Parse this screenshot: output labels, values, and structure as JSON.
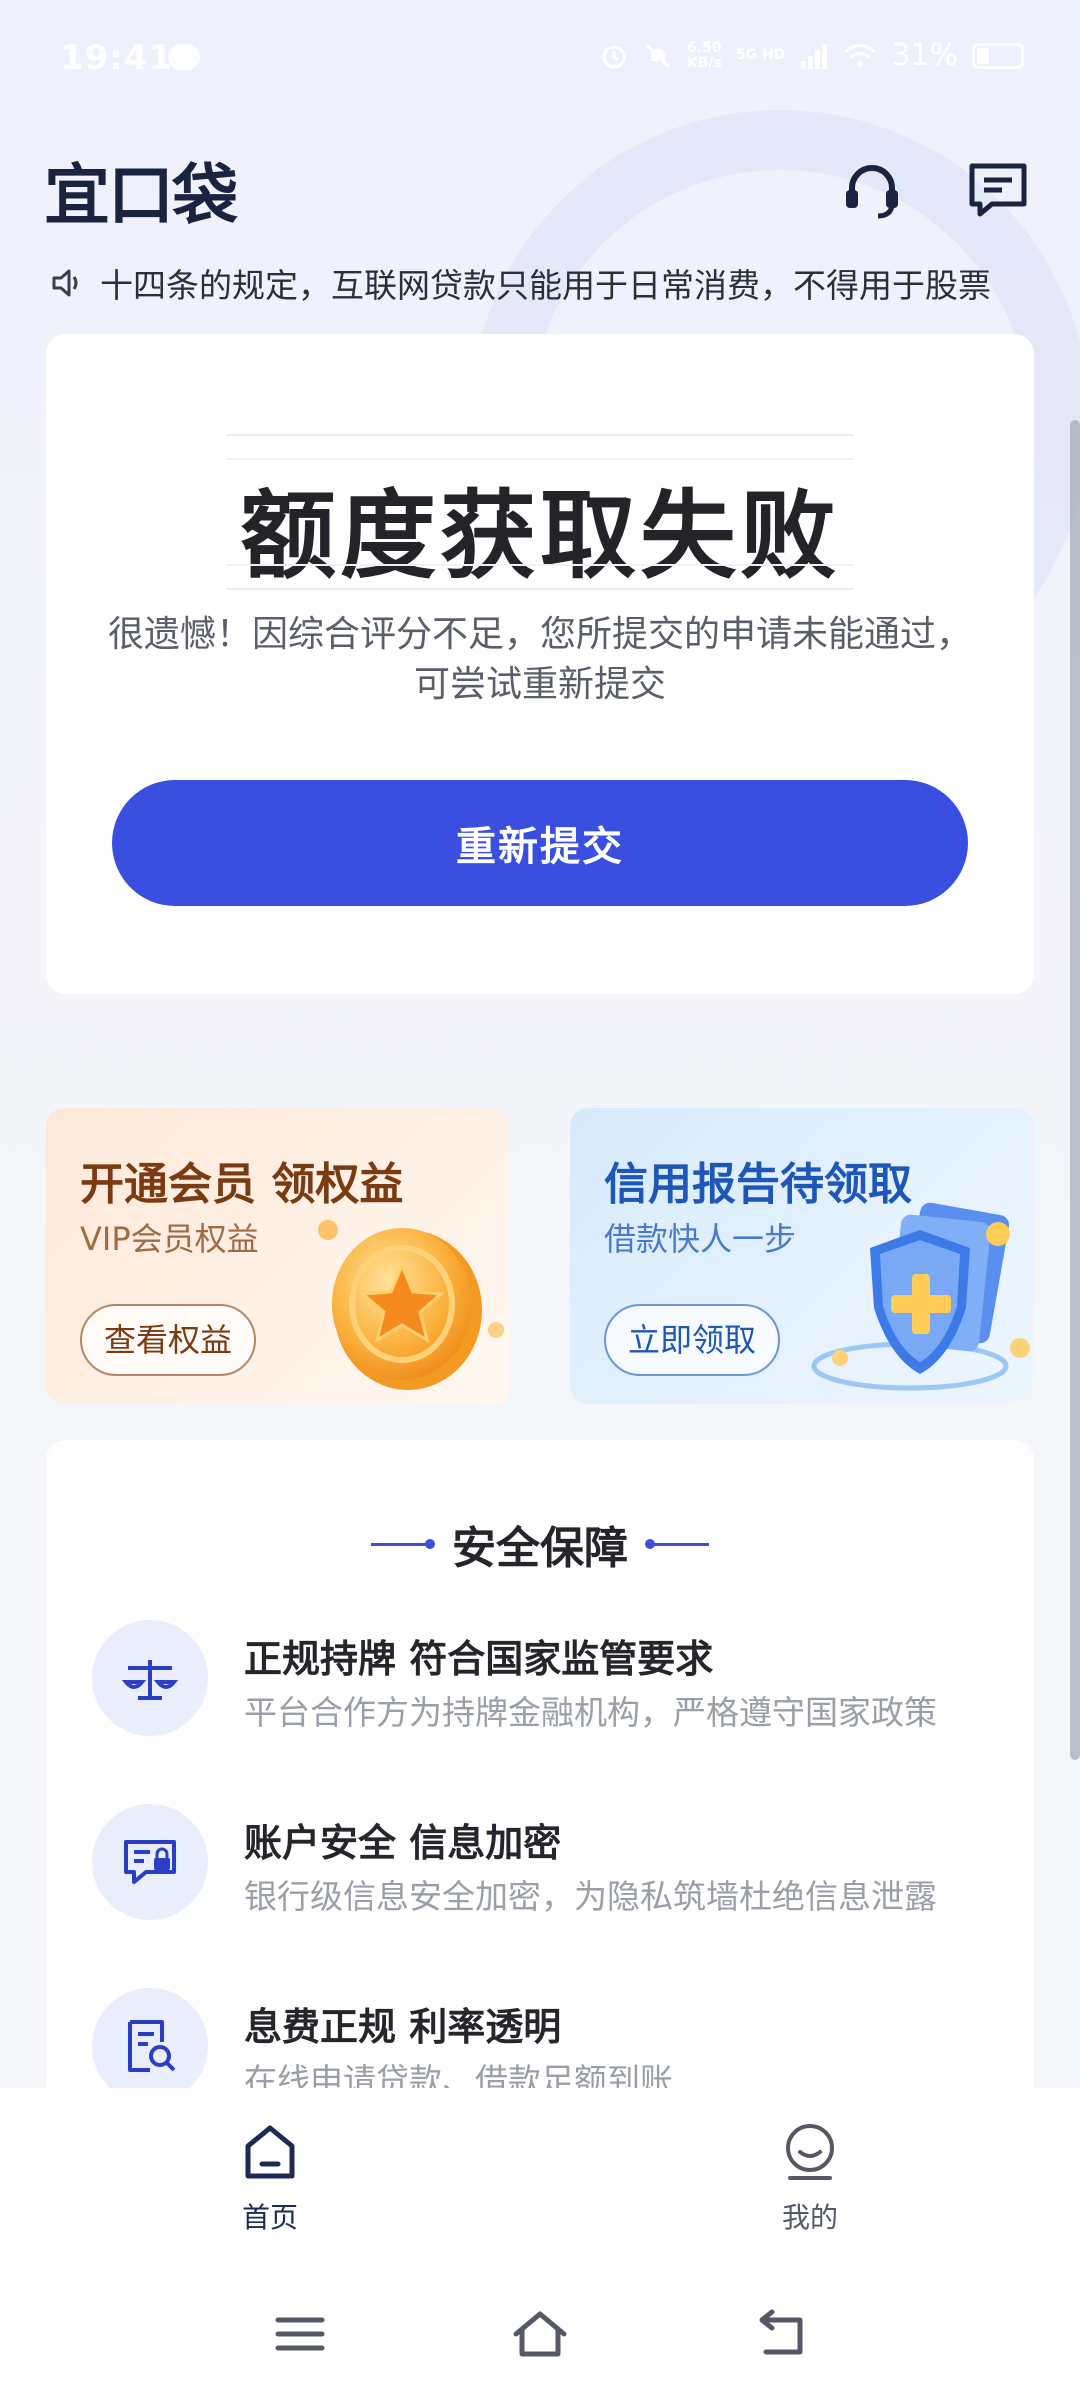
{
  "status_bar": {
    "time": "19:41",
    "speed_value": "6.50",
    "speed_unit": "KB/s",
    "network": "5G HD",
    "battery": "31%"
  },
  "header": {
    "logo": "宜口袋"
  },
  "notice": {
    "text": "十四条的规定，互联网贷款只能用于日常消费，不得用于股票"
  },
  "result": {
    "title": "额度获取失败",
    "description": "很遗憾！因综合评分不足，您所提交的申请未能通过，可尝试重新提交",
    "button_label": "重新提交"
  },
  "promos": [
    {
      "title": "开通会员 领权益",
      "subtitle": "VIP会员权益",
      "button_label": "查看权益"
    },
    {
      "title": "信用报告待领取",
      "subtitle": "借款快人一步",
      "button_label": "立即领取"
    }
  ],
  "safety": {
    "title": "安全保障",
    "items": [
      {
        "title": "正规持牌 符合国家监管要求",
        "desc": "平台合作方为持牌金融机构，严格遵守国家政策"
      },
      {
        "title": "账户安全 信息加密",
        "desc": "银行级信息安全加密，为隐私筑墙杜绝信息泄露"
      },
      {
        "title": "息费正规  利率透明",
        "desc": "在线申请贷款、借款足额到账"
      }
    ]
  },
  "bottom_nav": {
    "items": [
      {
        "label": "首页",
        "icon": "home-icon",
        "active": true
      },
      {
        "label": "我的",
        "icon": "profile-icon",
        "active": false
      }
    ]
  },
  "colors": {
    "primary": "#3a4fe0",
    "vip_text": "#7a3a12",
    "credit_text": "#1f57b8"
  }
}
